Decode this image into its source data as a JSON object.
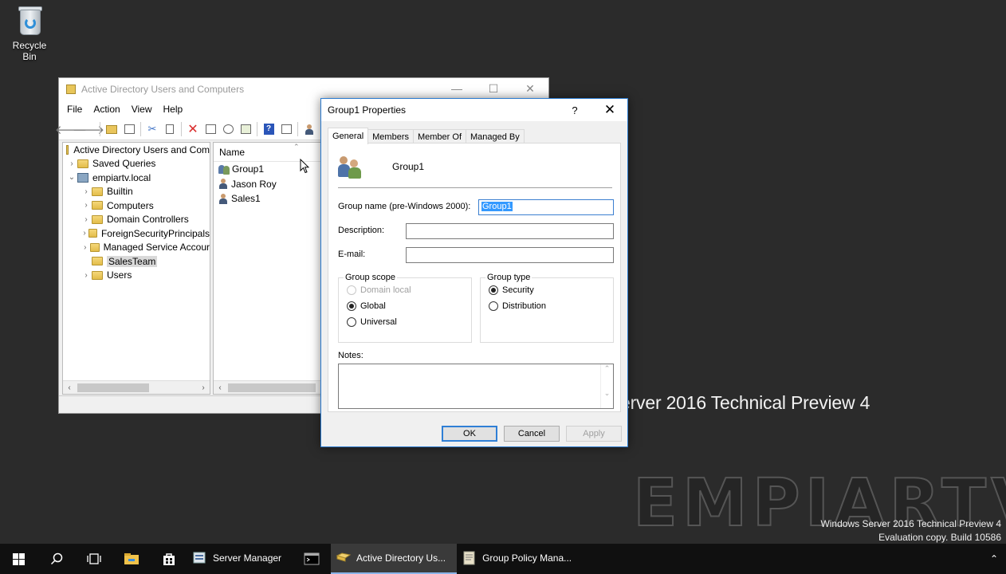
{
  "desktop": {
    "recycle_bin_label": "Recycle Bin",
    "os_title": "erver 2016 Technical Preview 4",
    "logo_text": "EMPIARTV",
    "build_line1": "Windows Server 2016 Technical Preview 4",
    "build_line2": "Evaluation copy. Build 10586"
  },
  "aduc": {
    "title": "Active Directory Users and Computers",
    "window_controls": [
      "—",
      "☐",
      "✕"
    ],
    "menu": [
      "File",
      "Action",
      "View",
      "Help"
    ],
    "tree": {
      "root": "Active Directory Users and Com",
      "saved_queries": "Saved Queries",
      "domain": "empiartv.local",
      "children": [
        {
          "label": "Builtin",
          "type": "folder"
        },
        {
          "label": "Computers",
          "type": "folder"
        },
        {
          "label": "Domain Controllers",
          "type": "ou"
        },
        {
          "label": "ForeignSecurityPrincipals",
          "type": "folder"
        },
        {
          "label": "Managed Service Accour",
          "type": "folder"
        },
        {
          "label": "SalesTeam",
          "type": "ou",
          "selected": true
        },
        {
          "label": "Users",
          "type": "folder"
        }
      ]
    },
    "list": {
      "column_name": "Name",
      "items": [
        {
          "label": "Group1",
          "type": "group"
        },
        {
          "label": "Jason Roy",
          "type": "user"
        },
        {
          "label": "Sales1",
          "type": "user"
        }
      ]
    }
  },
  "dialog": {
    "title": "Group1 Properties",
    "help": "?",
    "close": "✕",
    "tabs": [
      "General",
      "Members",
      "Member Of",
      "Managed By"
    ],
    "active_tab": "General",
    "group_display_name": "Group1",
    "labels": {
      "group_name": "Group name (pre-Windows 2000):",
      "description": "Description:",
      "email": "E-mail:",
      "notes": "Notes:"
    },
    "values": {
      "group_name": "Group1",
      "description": "",
      "email": ""
    },
    "group_scope": {
      "legend": "Group scope",
      "options": [
        "Domain local",
        "Global",
        "Universal"
      ],
      "selected": "Global",
      "disabled": [
        "Domain local"
      ]
    },
    "group_type": {
      "legend": "Group type",
      "options": [
        "Security",
        "Distribution"
      ],
      "selected": "Security"
    },
    "buttons": {
      "ok": "OK",
      "cancel": "Cancel",
      "apply": "Apply"
    }
  },
  "taskbar": {
    "apps": [
      {
        "label": "Server Manager",
        "active": false
      },
      {
        "label": "Active Directory Us...",
        "active": true
      },
      {
        "label": "Group Policy Mana...",
        "active": false
      }
    ],
    "tray": "⌃"
  }
}
